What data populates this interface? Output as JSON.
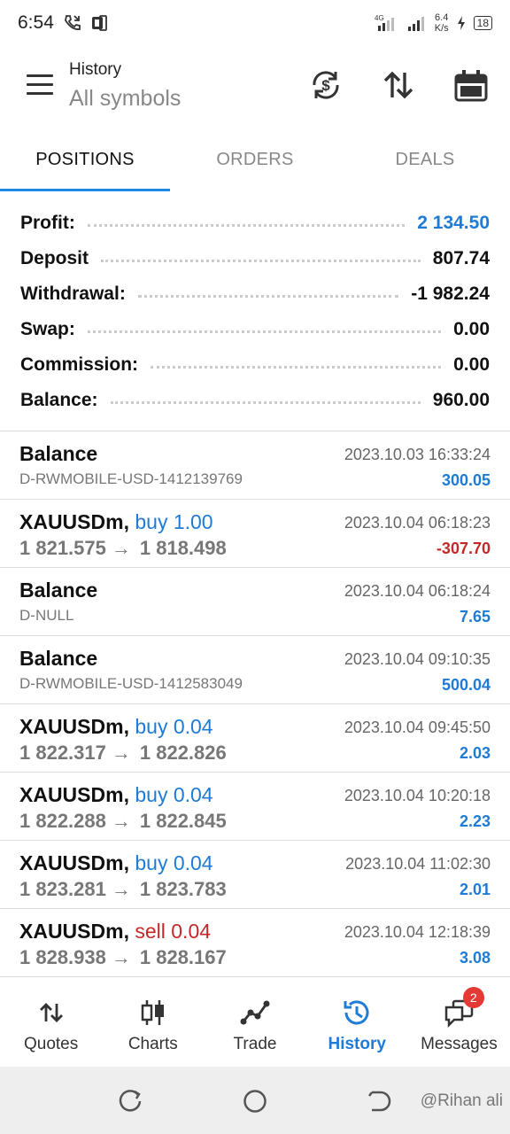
{
  "status_bar": {
    "time": "6:54",
    "net_speed_value": "6.4",
    "net_speed_unit": "K/s",
    "network": "4G",
    "battery": "18"
  },
  "header": {
    "title": "History",
    "subtitle": "All symbols"
  },
  "tabs": [
    {
      "label": "POSITIONS",
      "active": true
    },
    {
      "label": "ORDERS",
      "active": false
    },
    {
      "label": "DEALS",
      "active": false
    }
  ],
  "summary": [
    {
      "label": "Profit:",
      "value": "2 134.50"
    },
    {
      "label": "Deposit",
      "value": "807.74"
    },
    {
      "label": "Withdrawal:",
      "value": "-1 982.24"
    },
    {
      "label": "Swap:",
      "value": "0.00"
    },
    {
      "label": "Commission:",
      "value": "0.00"
    },
    {
      "label": "Balance:",
      "value": "960.00"
    }
  ],
  "deals": [
    {
      "name": "Balance",
      "sub": "D-RWMOBILE-USD-1412139769",
      "date": "2023.10.03 16:33:24",
      "amount": "300.05"
    },
    {
      "symbol": "XAUUSDm,",
      "side": "buy 1.00",
      "open_price": "1 821.575",
      "close_price": "1 818.498",
      "date": "2023.10.04 06:18:23",
      "amount": "-307.70"
    },
    {
      "name": "Balance",
      "sub": "D-NULL",
      "date": "2023.10.04 06:18:24",
      "amount": "7.65"
    },
    {
      "name": "Balance",
      "sub": "D-RWMOBILE-USD-1412583049",
      "date": "2023.10.04 09:10:35",
      "amount": "500.04"
    },
    {
      "symbol": "XAUUSDm,",
      "side": "buy 0.04",
      "open_price": "1 822.317",
      "close_price": "1 822.826",
      "date": "2023.10.04 09:45:50",
      "amount": "2.03"
    },
    {
      "symbol": "XAUUSDm,",
      "side": "buy 0.04",
      "open_price": "1 822.288",
      "close_price": "1 822.845",
      "date": "2023.10.04 10:20:18",
      "amount": "2.23"
    },
    {
      "symbol": "XAUUSDm,",
      "side": "buy 0.04",
      "open_price": "1 823.281",
      "close_price": "1 823.783",
      "date": "2023.10.04 11:02:30",
      "amount": "2.01"
    },
    {
      "symbol": "XAUUSDm,",
      "side": "sell 0.04",
      "open_price": "1 828.938",
      "close_price": "1 828.167",
      "date": "2023.10.04 12:18:39",
      "amount": "3.08"
    }
  ],
  "price_arrow": "→",
  "bottom_nav": [
    {
      "label": "Quotes",
      "icon": "quotes-icon"
    },
    {
      "label": "Charts",
      "icon": "charts-icon"
    },
    {
      "label": "Trade",
      "icon": "trade-icon"
    },
    {
      "label": "History",
      "icon": "history-icon",
      "active": true
    },
    {
      "label": "Messages",
      "icon": "messages-icon",
      "badge": "2"
    }
  ],
  "watermark": "@Rihan ali",
  "colors": {
    "accent": "#1e7bd6",
    "negative": "#c62828",
    "badge": "#e53935"
  }
}
